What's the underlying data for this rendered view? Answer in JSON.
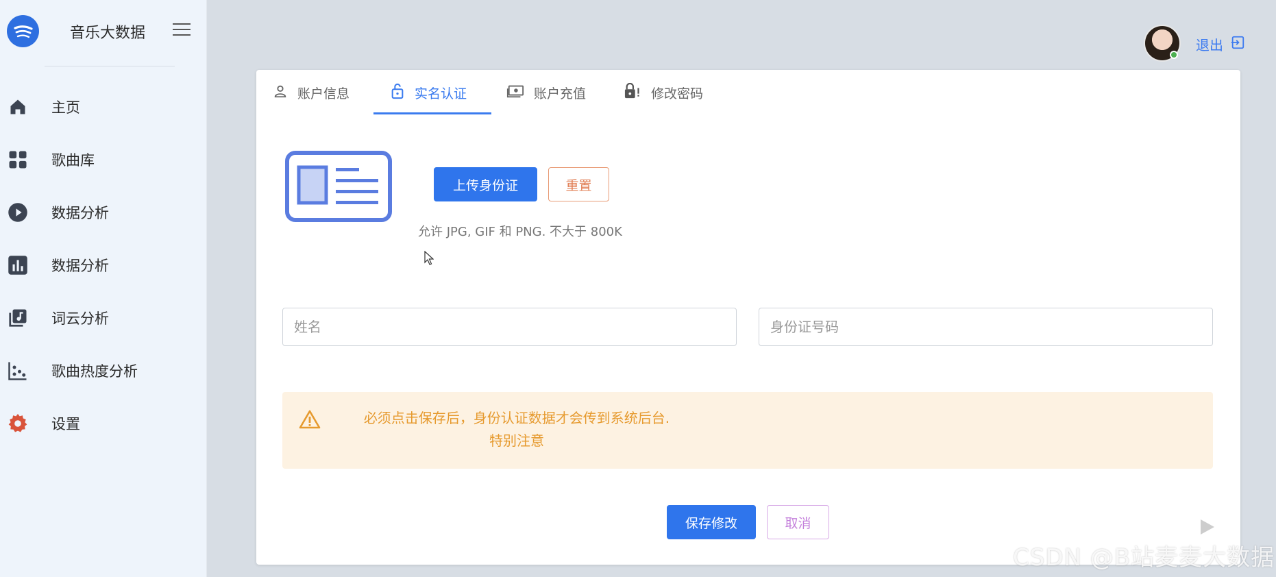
{
  "brand": {
    "name": "音乐大数据",
    "logo_icon": "spotify-logo-icon",
    "accent": "#2e6fe0"
  },
  "sidebar": {
    "items": [
      {
        "label": "主页",
        "icon": "home-icon"
      },
      {
        "label": "歌曲库",
        "icon": "grid-icon"
      },
      {
        "label": "数据分析",
        "icon": "play-circle-icon"
      },
      {
        "label": "数据分析",
        "icon": "bar-chart-icon"
      },
      {
        "label": "词云分析",
        "icon": "music-library-icon"
      },
      {
        "label": "歌曲热度分析",
        "icon": "scatter-chart-icon"
      },
      {
        "label": "设置",
        "icon": "gear-icon",
        "color": "#d9533a"
      }
    ]
  },
  "user": {
    "logout_label": "退出"
  },
  "tabs": [
    {
      "label": "账户信息",
      "icon": "user-icon",
      "active": false
    },
    {
      "label": "实名认证",
      "icon": "lock-open-icon",
      "active": true
    },
    {
      "label": "账户充值",
      "icon": "cash-icon",
      "active": false
    },
    {
      "label": "修改密码",
      "icon": "lock-alert-icon",
      "active": false
    }
  ],
  "id_upload": {
    "upload_label": "上传身份证",
    "reset_label": "重置",
    "hint": "允许 JPG, GIF 和 PNG. 不大于 800K"
  },
  "form": {
    "name_placeholder": "姓名",
    "name_value": "",
    "id_placeholder": "身份证号码",
    "id_value": ""
  },
  "alert": {
    "line1": "必须点击保存后，身份认证数据才会传到系统后台.",
    "line2": "特别注意",
    "color": "#e69a2e"
  },
  "actions": {
    "save_label": "保存修改",
    "cancel_label": "取消"
  },
  "watermark": {
    "csdn": "CSDN @B站麦麦大数据"
  },
  "colors": {
    "primary": "#2f75ec",
    "sidebar_bg": "#eef4fb",
    "page_bg": "#d7dde4"
  }
}
